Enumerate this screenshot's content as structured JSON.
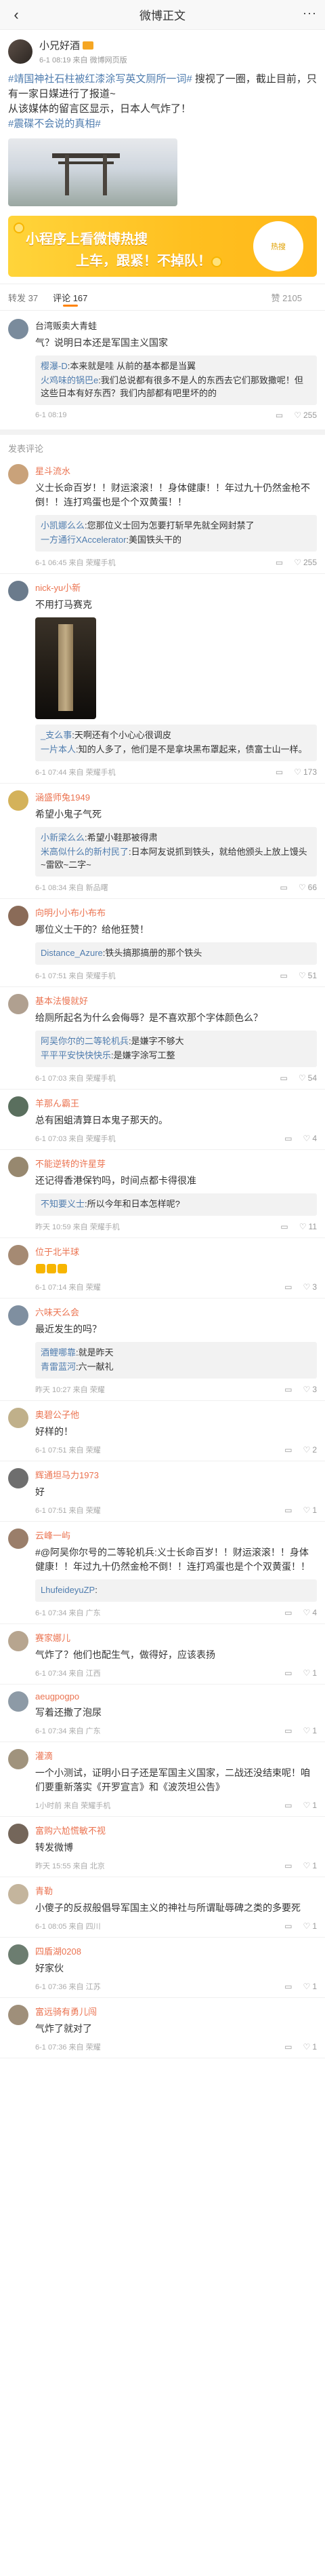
{
  "topbar": {
    "back_glyph": "‹",
    "title": "微博正文",
    "more_glyph": "···"
  },
  "post": {
    "author": "小兄好酒",
    "meta": "6-1 08:19 来自 微博网页版",
    "text_hashtag": "#靖国神社石柱被红漆涂写英文厕所一词#",
    "text_body": " 搜视了一圈，截止目前，只有一家日媒进行了报道~",
    "text_line2": "从该媒体的留言区显示，日本人气炸了！",
    "text_hashtag2": "#震碟不会说的真相#"
  },
  "banner": {
    "line1": "小程序上看微博热搜",
    "line2": "上车，跟紧！不掉队！",
    "badge": "热搜"
  },
  "tabs": {
    "repost": "转发 37",
    "comments": "评论 167",
    "likes": "赞 2105"
  },
  "hot_comment": {
    "name": "台湾贩卖大青蛙",
    "text": "气？说明日本还是军国主义国家",
    "replies": [
      {
        "name": "樱瀑-D",
        "text": ":本来就是哇 从前的基本都是当翼"
      },
      {
        "name": "火鸡味的锅巴e",
        "text": ":我们总说都有很多不是人的东西去它们那致撒呢！但这些日本有好东西？我们内部都有吧里坏的的"
      }
    ],
    "time": "6-1 08:19",
    "like_count": "255"
  },
  "section_label": "发表评论",
  "comments": [
    {
      "name": "星斗流水",
      "text": "义士长命百岁！！财运滚滚！！身体健康！！年过九十仍然金枪不倒！！连打鸡蛋也是个个双黄蛋！！",
      "replies": [
        {
          "name": "小凯娜么么",
          "text": ":您那位义士回为怎要打斩早先就全网封禁了"
        },
        {
          "name": "一方通行XAccelerator",
          "text": ":美国铁头干的"
        }
      ],
      "time": "6-1 06:45 来自 荣耀手机",
      "likes": "255"
    },
    {
      "name": "nick-yu小新",
      "text": "不用打马赛克",
      "has_video": true,
      "replies": [
        {
          "name": "_支么事",
          "text": ":天啊还有个小心心很调皮"
        },
        {
          "name": "一片本人",
          "text": ":知的人多了，他们是不是拿块黑布罩起来，债富士山一样。"
        }
      ],
      "time": "6-1 07:44 来自 荣耀手机",
      "likes": "173"
    },
    {
      "name": "涵盛师兔1949",
      "text": "希望小鬼子气死",
      "replies": [
        {
          "name": "小新梁么么",
          "text": ":希望小鞋那被得肃"
        },
        {
          "name": "米高似什么的新村民了",
          "text": ":日本阿友说抓到铁头，就给他颁头上放上馒头~雷欧~二字~"
        }
      ],
      "time": "6-1 08:34 来自 新品曙",
      "likes": "66"
    },
    {
      "name": "向明小小布小布布",
      "text": "哪位义士干的？给他狂赞！",
      "replies": [
        {
          "name": "Distance_Azure",
          "text": ":铁头搞那搞册的那个铁头"
        }
      ],
      "time": "6-1 07:51 来自 荣耀手机",
      "likes": "51"
    },
    {
      "name": "基本法慢就好",
      "text": "给厕所起名为什么会侮辱？是不喜欢那个字体颜色么？",
      "replies": [
        {
          "name": "阿吴你尔的二等轮机兵",
          "text": ":是嫌字不够大"
        },
        {
          "name": "平平平安快快快乐",
          "text": ":是嫌字涂写工整"
        }
      ],
      "time": "6-1 07:03 来自 荣耀手机",
      "likes": "54"
    },
    {
      "name": "羊那ん霸王",
      "text": "总有困蛆清算日本鬼子那天的。",
      "time": "6-1 07:03 来自 荣耀手机",
      "likes": "4"
    },
    {
      "name": "不能逆转的许星芽",
      "text": "还记得香港保钓吗，时间点都卡得很准",
      "replies": [
        {
          "name": "不知要义士",
          "text": ":所以今年和日本怎样呢?"
        }
      ],
      "time": "昨天 10:59 来自 荣耀手机",
      "likes": "11"
    },
    {
      "name": "位于北半球",
      "text": "",
      "emoji_only": true,
      "time": "6-1 07:14 来自 荣耀",
      "likes": "3"
    },
    {
      "name": "六味天么会",
      "text": "最近发生的吗？",
      "replies": [
        {
          "name": "酒鲤哪靠",
          "text": ":就是昨天"
        },
        {
          "name": "青雷蓝河",
          "text": ":六一献礼"
        }
      ],
      "time": "昨天 10:27 来自 荣耀",
      "likes": "3"
    },
    {
      "name": "奥碧公子他",
      "text": "好样的！",
      "time": "6-1 07:51 来自 荣耀",
      "likes": "2"
    },
    {
      "name": "辉通坦马力1973",
      "text": "好",
      "time": "6-1 07:51 来自 荣耀",
      "likes": "1"
    },
    {
      "name": "云峰一屿",
      "text": "#@阿吴你尔号的二等轮机兵:义士长命百岁！！财运滚滚！！身体健康！！年过九十仍然金枪不倒！！连打鸡蛋也是个个双黄蛋！！",
      "replies": [
        {
          "name": "LhufeideyuZP",
          "text": ":"
        }
      ],
      "time": "6-1 07:34 来自 广东",
      "likes": "4"
    },
    {
      "name": "赛家娜儿",
      "text": "气炸了？他们也配生气，做得好，应该表扬",
      "time": "6-1 07:34 来自 江西",
      "likes": "1"
    },
    {
      "name": "aeugpogpo",
      "text": "写着还撒了泡尿",
      "time": "6-1 07:34 来自 广东",
      "likes": "1"
    },
    {
      "name": "灌滴",
      "text": "一个小测试，证明小日子还是军国主义国家，二战还没结束呢！咱们要重新落实《开罗宣言》和《波茨坦公告》",
      "time": "1小时前 来自 荣耀手机",
      "likes": "1"
    },
    {
      "name": "富购六尬慌敏不视",
      "text": "转发微博",
      "time": "昨天 15:55 来自 北京",
      "likes": "1"
    },
    {
      "name": "青勒",
      "text": "小傻子的反叔般倡导军国主义的神社与所谓耻辱碑之类的多要死",
      "time": "6-1 08:05 来自 四川",
      "likes": "1"
    },
    {
      "name": "四盾湖0208",
      "text": "好家伙",
      "time": "6-1 07:36 来自 江苏",
      "likes": "1"
    },
    {
      "name": "富远骑有勇儿闯",
      "text": "气炸了就对了",
      "time": "6-1 07:36 来自 荣耀",
      "likes": "1"
    }
  ],
  "colors": {
    "accent": "#ff8200",
    "name": "#eb7350",
    "link": "#507daf"
  }
}
